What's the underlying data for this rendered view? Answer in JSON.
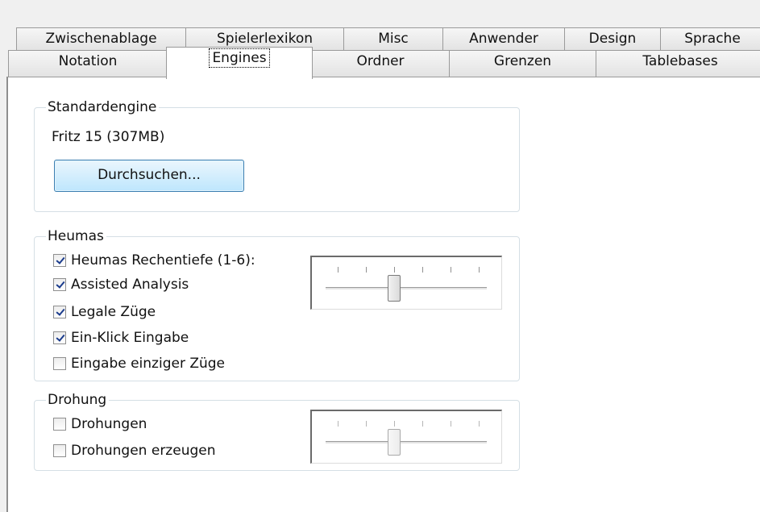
{
  "tabs_row1": [
    "Zwischenablage",
    "Spielerlexikon",
    "Misc",
    "Anwender",
    "Design",
    "Sprache"
  ],
  "tabs_row2": [
    "Notation",
    "Engines",
    "Ordner",
    "Grenzen",
    "Tablebases"
  ],
  "active_tab": "Engines",
  "standardengine": {
    "legend": "Standardengine",
    "engine_name": "Fritz 15  (307MB)",
    "browse_button": "Durchsuchen..."
  },
  "heumas": {
    "legend": "Heumas",
    "checkboxes": [
      {
        "label": "Heumas Rechentiefe (1-6):",
        "checked": true
      },
      {
        "label": "Assisted Analysis",
        "checked": true
      },
      {
        "label": "Legale Züge",
        "checked": true
      },
      {
        "label": "Ein-Klick Eingabe",
        "checked": true
      },
      {
        "label": "Eingabe einziger Züge",
        "checked": false
      }
    ],
    "depth_slider": {
      "min": 1,
      "max": 6,
      "value": 3,
      "enabled": true
    }
  },
  "drohung": {
    "legend": "Drohung",
    "checkboxes": [
      {
        "label": "Drohungen",
        "checked": false
      },
      {
        "label": "Drohungen erzeugen",
        "checked": false
      }
    ],
    "slider": {
      "min": 1,
      "max": 6,
      "value": 3,
      "enabled": false
    }
  }
}
